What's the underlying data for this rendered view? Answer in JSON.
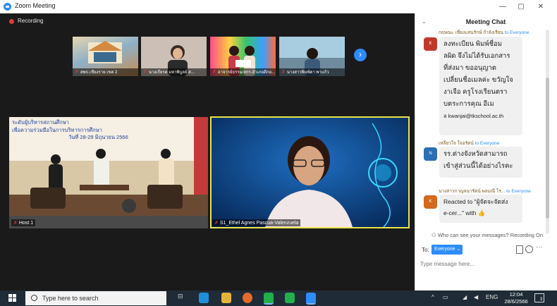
{
  "window": {
    "title": "Zoom Meeting",
    "minimize": "—",
    "maximize": "▢",
    "close": "✕"
  },
  "recording": {
    "label": "Recording"
  },
  "thumbnails": [
    {
      "name": "สพป.เชียงราย เขต 2"
    },
    {
      "name": "นางเกียรต มหาพิบูลย์ ส..."
    },
    {
      "name": "อาจารย์ธรรม/สกร.อำเภอดีกอ..."
    },
    {
      "name": "นางสาวพิมพ์ตา พาแก้ว"
    }
  ],
  "main_videos": {
    "host_label": "Host 1",
    "speaker_label": "S1_Ethel Agnes Pascua-Valenzuela",
    "slide_lines": [
      "ระดับผู้บริหารสถานศึกษา",
      "เพื่อความร่วมมือในการบริหารการศึกษา",
      "วันที่ 28-29 มิถุนายน 2566"
    ]
  },
  "chat": {
    "title": "Meeting Chat",
    "messages": [
      {
        "sender": "กฤษณะ เชียงแสนรักษ์ กำลังเรียน",
        "to": "to Everyone",
        "avatar": "K",
        "avatar_color": "#c0392b",
        "lines": [
          "ลงทะเบียน พิมพ์ชื่อม",
          "ลผิด จึงไม่ได้รับเอกสาร",
          "ที่ส่งมา ขออนุญาต",
          "เปลี่ยนชื่อเมลค่ะ ขวัญใจ",
          "งาเจือ ครูโรงเรียนตรา",
          "บตระการคุณ อีเม",
          "ล kwanjai@tkschool.ac.th"
        ]
      },
      {
        "sender": "เหลียวใจ ใจอรัตน์",
        "to": "to Everyone",
        "avatar": "N",
        "avatar_color": "#2d6fb3",
        "lines": [
          "รร.ต่างจังหวัดสามารถ",
          "เข้าสู่ส่วนนี้ได้อย่างไรคะ"
        ]
      },
      {
        "sender": "นางสาวกาญจนารัตน์  พลมณี  โร...",
        "to": "to Everyone",
        "avatar": "K",
        "avatar_color": "#d2691e",
        "lines": [
          "Reacted to \"ผู้จัดจะจัดส่ง",
          "e-cer...\" with 👍"
        ]
      }
    ],
    "who_can_see": "Who can see your messages? Recording On",
    "to_label": "To:",
    "recipient": "Everyone ⌄",
    "input_placeholder": "Type message here..."
  },
  "taskbar": {
    "search_placeholder": "Type here to search",
    "lang": "ENG",
    "time": "12:04",
    "date": "28/6/2566",
    "notifications": "3"
  }
}
